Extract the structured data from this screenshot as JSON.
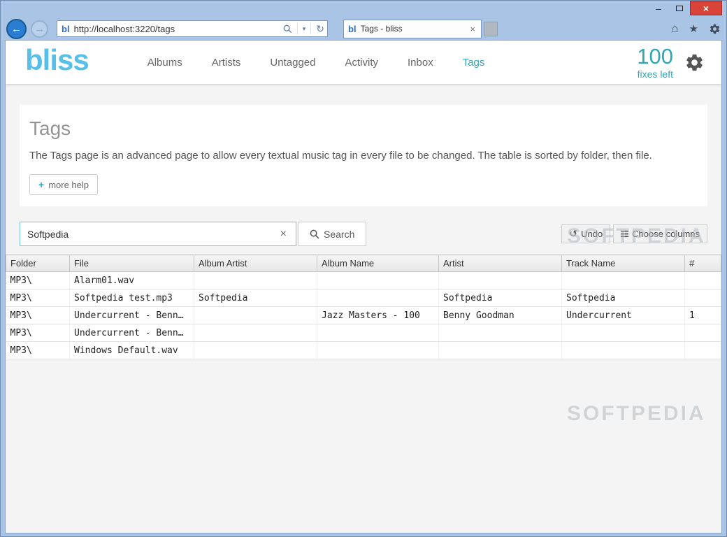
{
  "browser": {
    "address": {
      "favicon": "bl",
      "url": "http://localhost:3220/tags"
    },
    "tab": {
      "favicon": "bl",
      "title": "Tags - bliss"
    }
  },
  "glyphs": {
    "back": "←",
    "forward": "→",
    "dropdown": "▾",
    "refresh": "↻",
    "tab_close": "×",
    "home": "⌂",
    "star": "★",
    "minimize": "–",
    "close": "×",
    "plus": "+",
    "clear": "×",
    "undo": "↺"
  },
  "header": {
    "logo": "bliss",
    "nav": [
      {
        "label": "Albums",
        "active": false
      },
      {
        "label": "Artists",
        "active": false
      },
      {
        "label": "Untagged",
        "active": false
      },
      {
        "label": "Activity",
        "active": false
      },
      {
        "label": "Inbox",
        "active": false
      },
      {
        "label": "Tags",
        "active": true
      }
    ],
    "fixes_count": "100",
    "fixes_label": "fixes left"
  },
  "page": {
    "title": "Tags",
    "description": "The Tags page is an advanced page to allow every textual music tag in every file to be changed. The table is sorted by folder, then file.",
    "more_help": "more help"
  },
  "toolbar": {
    "search_value": "Softpedia",
    "search_button": "Search",
    "undo_button": "Undo",
    "choose_columns_button": "Choose columns"
  },
  "table": {
    "headers": [
      "Folder",
      "File",
      "Album Artist",
      "Album Name",
      "Artist",
      "Track Name",
      "#"
    ],
    "rows": [
      [
        "MP3\\",
        "Alarm01.wav",
        "",
        "",
        "",
        "",
        ""
      ],
      [
        "MP3\\",
        "Softpedia test.mp3",
        "Softpedia",
        "",
        "Softpedia",
        "Softpedia",
        ""
      ],
      [
        "MP3\\",
        "Undercurrent - Benn…",
        "",
        "Jazz Masters - 100",
        "Benny Goodman",
        "Undercurrent",
        "1"
      ],
      [
        "MP3\\",
        "Undercurrent - Benn…",
        "",
        "",
        "",
        "",
        ""
      ],
      [
        "MP3\\",
        "Windows Default.wav",
        "",
        "",
        "",
        "",
        ""
      ]
    ]
  },
  "watermark": "SOFTPEDIA",
  "colors": {
    "accent_teal": "#2fa7b4",
    "logo_blue": "#58bfe8",
    "frame_blue": "#a9c4e4"
  }
}
